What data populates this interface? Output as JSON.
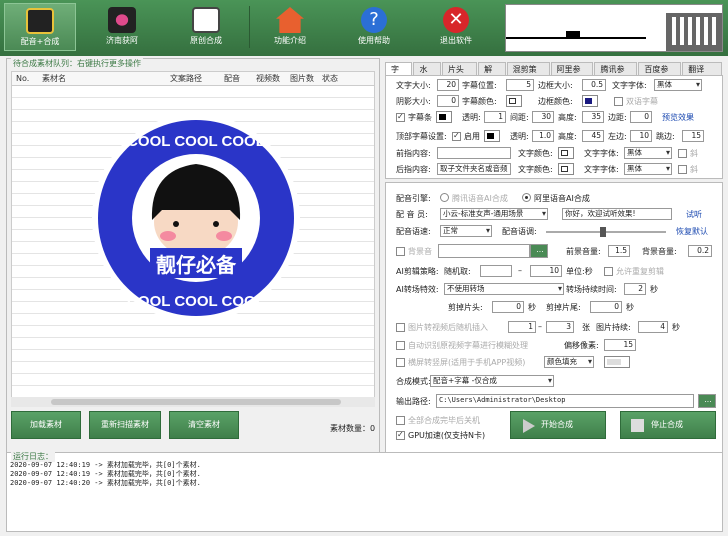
{
  "toolbar": [
    {
      "label": "配音+合成",
      "icon": "clapper-icon"
    },
    {
      "label": "济南获阿",
      "icon": "film-reel-icon"
    },
    {
      "label": "原创合成",
      "icon": "image-edit-icon"
    },
    {
      "label": "功能介绍",
      "icon": "home-icon"
    },
    {
      "label": "使用帮助",
      "icon": "help-icon"
    },
    {
      "label": "退出软件",
      "icon": "exit-icon"
    }
  ],
  "queue": {
    "title": "待合成素材队列：右键执行更多操作",
    "columns": [
      "No.",
      "素材名",
      "文案路径",
      "配音",
      "视频数",
      "图片数",
      "状态"
    ],
    "logo_text_top": "COOL COOL COOL",
    "logo_text_bottom": "COOL COOL COOL",
    "logo_label": "靓仔必备",
    "buttons": [
      "加载素材",
      "重新扫描素材",
      "清空素材"
    ],
    "count_label": "素材数量：",
    "count": "0"
  },
  "tabs": [
    "字幕",
    "水印",
    "片头尾",
    "解说",
    "混剪策略",
    "阿里参数",
    "腾讯参数",
    "百度参数",
    "翻译API"
  ],
  "subtitle": {
    "font_size_label": "文字大小:",
    "font_size": "20",
    "pos_label": "字幕位置:",
    "pos": "5",
    "border_label": "边框大小:",
    "border": "0.5",
    "font_label": "文字字体:",
    "font": "黑体",
    "shadow_label": "阴影大小:",
    "shadow": "0",
    "color_label": "字幕颜色:",
    "border_color_label": "边框颜色:",
    "bilingual_label": "双语字幕",
    "bar_label": "字幕条",
    "opacity_label": "透明:",
    "opacity": "1",
    "spacing_label": "间距:",
    "spacing": "30",
    "height_label": "高度:",
    "height": "35",
    "margin_label": "边距:",
    "margin": "0",
    "preview_link": "预览效果",
    "vsub_label": "顶部字幕设置:",
    "enable_label": "启用",
    "vopacity": "1.0",
    "vheight": "45",
    "left_label": "左边:",
    "vleft": "10",
    "gap_label": "跳边:",
    "vgap": "15",
    "prefix_label": "前指内容:",
    "prefix": "",
    "pcolor_label": "文字颜色:",
    "pfont_label": "文字字体:",
    "pfont": "黑体",
    "italic_label": "斜",
    "suffix_label": "后指内容:",
    "suffix": "取子文件夹名或音频",
    "scolor_label": "文字颜色:",
    "sfont_label": "文字字体:",
    "sfont": "黑体"
  },
  "voice": {
    "engine_label": "配音引擎:",
    "engine_opt1": "腾讯语音AI合成",
    "engine_opt2": "阿里语音AI合成",
    "speaker_label": "配  音  员:",
    "speaker": "小云-标准女声-通用场景",
    "test_text": "你好，欢迎试听效果!",
    "test_link": "试听",
    "speed_label": "配音语速:",
    "speed": "正常",
    "tone_label": "配音语调:",
    "reset_link": "恢复默认",
    "bgm_label": "背景音",
    "bgm_btn": "...",
    "front_vol_label": "前景音量:",
    "front_vol": "1.5",
    "back_vol_label": "背景音量:",
    "back_vol": "0.2",
    "ai_clip_label": "AI剪辑策略:",
    "random_label": "随机取:",
    "rand_from": "",
    "rand_to": "10",
    "unit_label": "单位:秒",
    "repeat_label": "允许重复剪辑",
    "trans_label": "AI转场特效:",
    "trans": "不使用转场",
    "trans_time_label": "转场持续时间:",
    "trans_time": "2",
    "sec": "秒",
    "head_cut_label": "剪掉片头:",
    "head_cut": "0",
    "tail_cut_label": "剪掉片尾:",
    "tail_cut": "0",
    "img_insert_label": "图片转视频后随机插入",
    "img_from": "1",
    "img_to": "3",
    "img_unit": "张",
    "img_dur_label": "图片持续:",
    "img_dur": "4",
    "blur_label": "自动识别原视频字幕进行模糊处理",
    "offset_label": "偏移像素:",
    "offset": "15",
    "landscape_label": "横屏转竖屏(适用于手机APP视频)",
    "fill_label": "颜色填充",
    "mode_label": "合成模式:",
    "mode": "配音+字幕 -仅合成",
    "out_label": "输出路径:",
    "out_path": "C:\\Users\\Administrator\\Desktop",
    "out_btn": "...",
    "shutdown_label": "全部合成完毕后关机",
    "gpu_label": "GPU加速(仅支持N卡)",
    "start_btn": "开始合成",
    "stop_btn": "停止合成"
  },
  "log": {
    "title": "运行日志：",
    "lines": [
      "2020-09-07 12:40:19 -> 素材加载完毕，共[0]个素材.",
      "2020-09-07 12:40:19 -> 素材加载完毕，共[0]个素材.",
      "2020-09-07 12:40:20 -> 素材加载完毕，共[0]个素材."
    ]
  },
  "colors": {
    "accent": "#3f7f4a",
    "logo_blue": "#2a35c8"
  }
}
